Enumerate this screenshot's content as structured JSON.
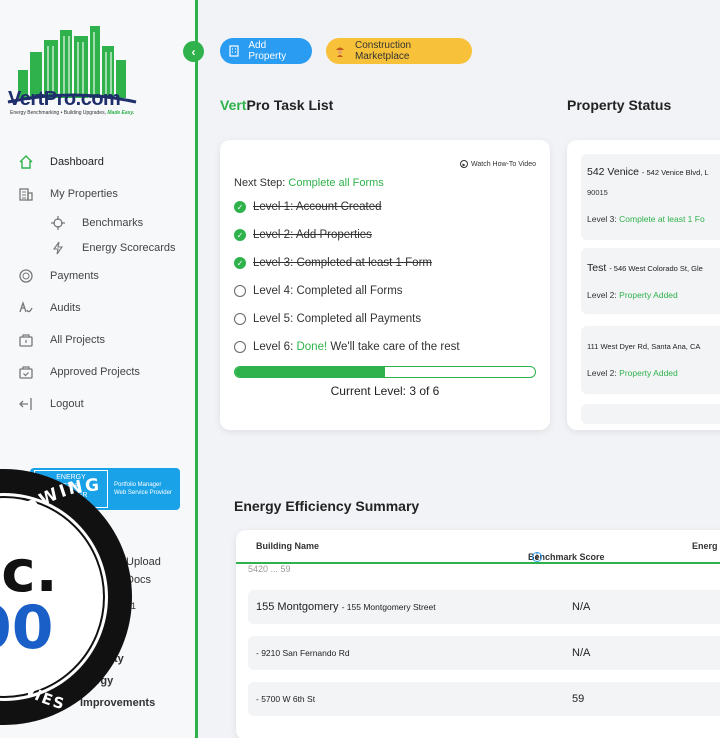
{
  "brand": {
    "name": "VertPro.com",
    "tagline": "Energy Benchmarking • Building Upgrades,",
    "tagline_emphasis": "Made Easy.",
    "primary_color": "#2fb24c",
    "accent_blue": "#2a9cf1",
    "accent_yellow": "#f7c23a"
  },
  "sidebar": {
    "items": [
      {
        "label": "Dashboard",
        "icon": "home-icon"
      },
      {
        "label": "My Properties",
        "icon": "building-icon"
      },
      {
        "label": "Benchmarks",
        "icon": "crosshair-icon"
      },
      {
        "label": "Energy Scorecards",
        "icon": "lightning-icon"
      },
      {
        "label": "Payments",
        "icon": "coin-icon"
      },
      {
        "label": "Audits",
        "icon": "signature-icon"
      },
      {
        "label": "All Projects",
        "icon": "projects-icon"
      },
      {
        "label": "Approved Projects",
        "icon": "approved-projects-icon"
      },
      {
        "label": "Logout",
        "icon": "logout-icon"
      }
    ],
    "energy_star": {
      "badge_lines": [
        "ENERGY",
        "STAR",
        "PARTNER"
      ],
      "text_line1": "Portfolio Manager",
      "text_line2": "Web Service Provider"
    },
    "under_badge": [
      "Upload",
      "Docs",
      "01",
      "ty",
      "ergy",
      "Improvements"
    ]
  },
  "inc_badge": {
    "top_text": "TEST-GROWING",
    "center": "nc.",
    "number": "00",
    "bottom_text": "COMPANIES"
  },
  "toolbar": {
    "add_property": "Add Property",
    "construction_marketplace": "Construction Marketplace"
  },
  "task_list": {
    "title_brand": "Vert",
    "title_rest": "Pro Task List",
    "watch_video": "Watch How-To Video",
    "next_step_label": "Next Step:",
    "next_step_value": "Complete all Forms",
    "tasks": [
      {
        "label": "Level 1: Account Created",
        "done": true
      },
      {
        "label": "Level 2: Add Properties",
        "done": true
      },
      {
        "label": "Level 3: Completed at least 1 Form",
        "done": true
      },
      {
        "label": "Level 4: Completed all Forms",
        "done": false
      },
      {
        "label": "Level 5: Completed all Payments",
        "done": false
      },
      {
        "label_prefix": "Level 6:",
        "label_done": "Done!",
        "label_rest": "We'll take care of the rest",
        "done": false
      }
    ],
    "progress_fraction": 0.5,
    "current_level": "Current Level: 3 of 6"
  },
  "property_status": {
    "title": "Property Status",
    "properties": [
      {
        "name": "542 Venice",
        "address": "- 542 Venice Blvd, L",
        "zip": "90015",
        "level_label": "Level 3:",
        "level_value": "Complete at least 1 Fo"
      },
      {
        "name": "Test",
        "address": "- 546 West Colorado St, Gle",
        "zip": "",
        "level_label": "Level 2:",
        "level_value": "Property Added"
      },
      {
        "name": "",
        "address": "111 West Dyer Rd, Santa Ana, CA",
        "zip": "",
        "level_label": "Level 2:",
        "level_value": "Property Added"
      }
    ]
  },
  "efficiency": {
    "title": "Energy Efficiency Summary",
    "columns": [
      "Building Name",
      "Benchmark Score",
      "Energ"
    ],
    "partial_row": "5420 ...  59",
    "rows": [
      {
        "name": "155 Montgomery",
        "address": "- 155 Montgomery Street",
        "score": "N/A"
      },
      {
        "name": "",
        "address": "- 9210 San Fernando Rd",
        "score": "N/A"
      },
      {
        "name": "",
        "address": "- 5700 W 6th St",
        "score": "59"
      }
    ]
  }
}
